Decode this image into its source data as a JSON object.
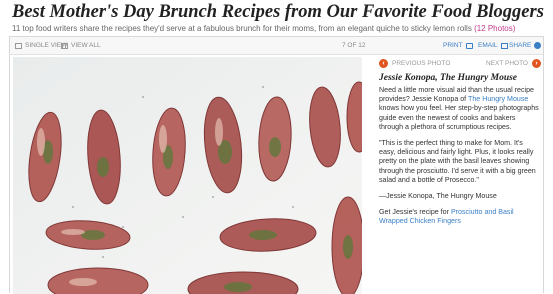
{
  "headline": "Best Mother's Day Brunch Recipes from Our Favorite Food Bloggers",
  "subline": {
    "text": "11 top food writers share the recipes they'd serve at a fabulous brunch for their moms, from an elegant quiche to sticky lemon rolls",
    "photos_link": "(12 Photos)"
  },
  "toolbar": {
    "single_view": "Single View",
    "view_all": "View All",
    "counter": "7 of 12",
    "print": "Print",
    "email": "Email",
    "share": "Share"
  },
  "nav": {
    "previous": "Previous Photo",
    "next": "Next Photo"
  },
  "caption": {
    "title": "Jessie Konopa, The Hungry Mouse",
    "p1_before": "Need a little more visual aid than the usual recipe provides? Jessie Konopa of ",
    "p1_link": "The Hungry Mouse",
    "p1_after": " knows how you feel. Her step-by-step photographs guide even the newest of cooks and bakers through a plethora of scrumptious recipes.",
    "quote": "\"This is the perfect thing to make for Mom. It's easy, delicious and fairly light. Plus, it looks really pretty on the plate with the basil leaves showing through the prosciutto. I'd serve it with a big green salad and a bottle of Prosecco.\"",
    "attribution": "—Jessie Konopa, The Hungry Mouse",
    "recipe_before": "Get Jessie's recipe for ",
    "recipe_link": "Prosciutto and Basil Wrapped Chicken Fingers"
  },
  "colors": {
    "photos_link": "#c23a8a",
    "link_blue": "#3b7fc4",
    "nav_arrow": "#e0541d"
  },
  "icons": {
    "single_view": "single-view-icon",
    "view_all": "grid-icon",
    "print": "printer-icon",
    "email": "envelope-icon",
    "share": "share-icon",
    "prev": "arrow-left-icon",
    "next": "arrow-right-icon"
  }
}
